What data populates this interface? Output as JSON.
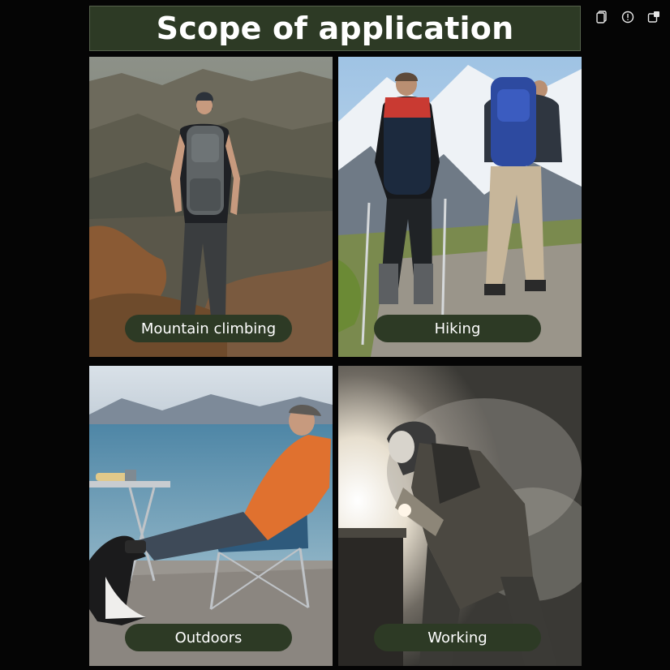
{
  "header": {
    "title": "Scope of application"
  },
  "toolbar": {
    "icons": [
      "copy-icon",
      "info-icon",
      "share-icon"
    ]
  },
  "tiles": [
    {
      "label": "Mountain climbing",
      "icon": "mountain-photo"
    },
    {
      "label": "Hiking",
      "icon": "hiking-photo"
    },
    {
      "label": "Outdoors",
      "icon": "outdoors-photo"
    },
    {
      "label": "Working",
      "icon": "welding-photo"
    }
  ],
  "colors": {
    "background": "#050505",
    "banner": "#2d3a25",
    "label_pill": "#2d3a25",
    "text": "#ffffff"
  }
}
